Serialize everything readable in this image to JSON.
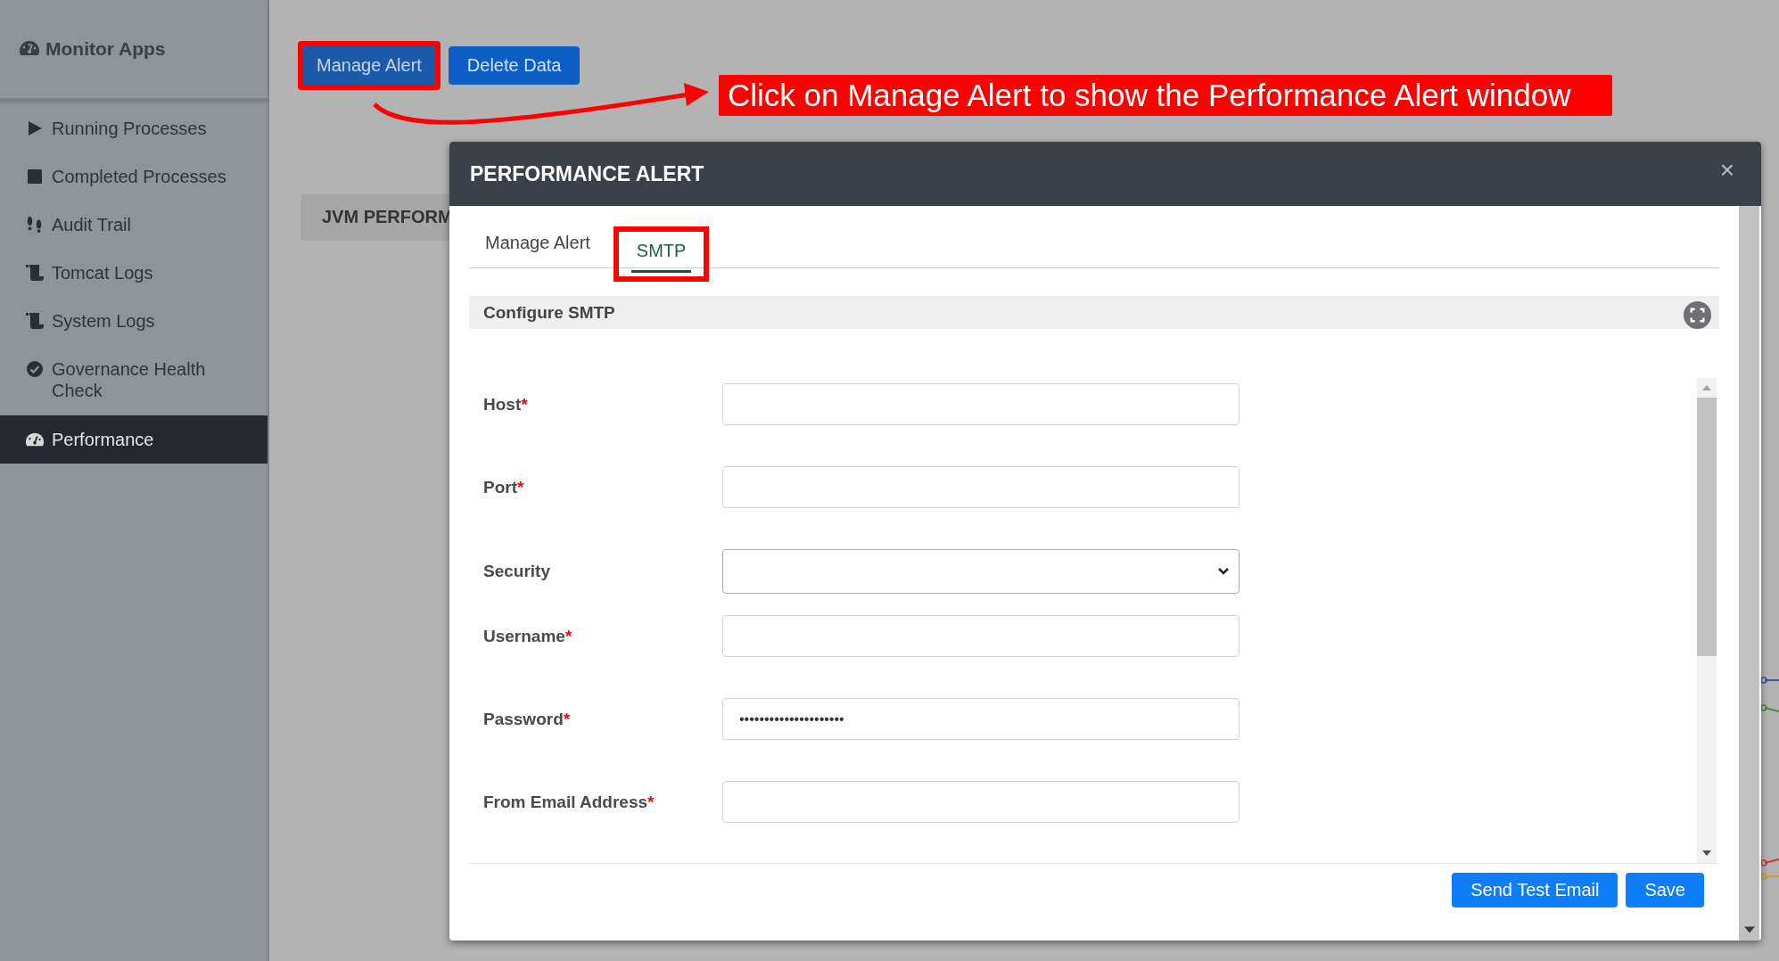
{
  "sidebar": {
    "title": "Monitor Apps",
    "items": [
      {
        "label": "Running Processes",
        "kind": "play",
        "selected": false
      },
      {
        "label": "Completed Processes",
        "kind": "stop",
        "selected": false
      },
      {
        "label": "Audit Trail",
        "kind": "footprints",
        "selected": false
      },
      {
        "label": "Tomcat Logs",
        "kind": "scroll",
        "selected": false
      },
      {
        "label": "System Logs",
        "kind": "scroll",
        "selected": false
      },
      {
        "label": "Governance Health Check",
        "kind": "check",
        "selected": false
      },
      {
        "label": "Performance",
        "kind": "gauge",
        "selected": true
      }
    ]
  },
  "toolbar": {
    "buttons": [
      {
        "label": "Manage Alert",
        "highlighted": true
      },
      {
        "label": "Delete Data",
        "highlighted": false
      }
    ]
  },
  "annotation": {
    "text": "Click on Manage Alert to show the Performance Alert window"
  },
  "panel": {
    "title": "JVM PERFORM"
  },
  "modal": {
    "title": "PERFORMANCE ALERT",
    "close": "×",
    "tabs": [
      {
        "label": "Manage Alert",
        "selected": false,
        "highlighted": false
      },
      {
        "label": "SMTP",
        "selected": true,
        "highlighted": true
      }
    ],
    "section": "Configure SMTP",
    "fields": [
      {
        "label": "Host",
        "required_mark": "*",
        "kind": "text"
      },
      {
        "label": "Port",
        "required_mark": "*",
        "kind": "text"
      },
      {
        "label": "Security",
        "kind": "select"
      },
      {
        "label": "Username",
        "required_mark": "*",
        "kind": "text"
      },
      {
        "label": "Password",
        "required_mark": "*",
        "kind": "text",
        "value": "•••••••••••••••••••••"
      },
      {
        "label": "From Email Address",
        "required_mark": "*",
        "kind": "text"
      }
    ],
    "buttons": [
      "Send Test Email",
      "Save"
    ]
  }
}
